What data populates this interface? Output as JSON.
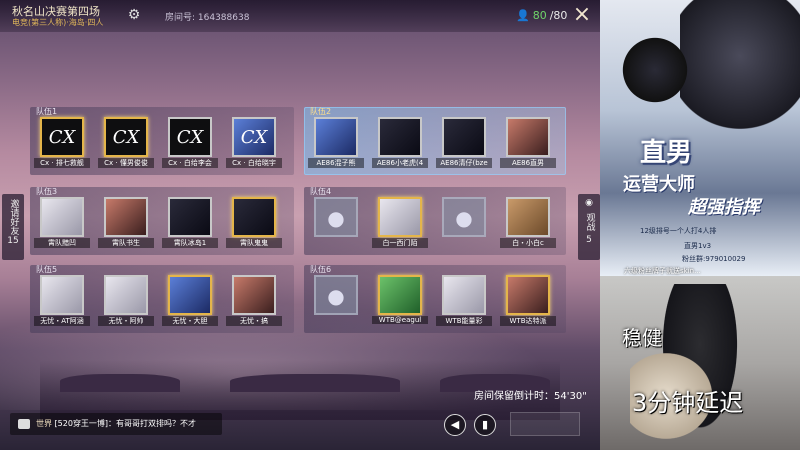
{
  "header": {
    "mode_title": "秋名山决赛第四场",
    "mode_sub": "电竞(第三人称)·海岛·四人",
    "room_label": "房间号: 164388638",
    "player_count_current": "80",
    "player_count_total": "/80",
    "close_icon": "×"
  },
  "teams": [
    {
      "label": "队伍1",
      "highlighted": false,
      "players": [
        "Cx · 排七救舰",
        "Cx · 懂男俊俊",
        "Cx · 白给李会",
        "Cx · 白给晓宇"
      ]
    },
    {
      "label": "队伍2",
      "highlighted": true,
      "players": [
        "AE86混子熊",
        "AE86小老虎(4",
        "AE86清仔(bze",
        "AE86直男"
      ]
    },
    {
      "label": "队伍3",
      "highlighted": false,
      "players": [
        "霄队黯凹",
        "霄队书生",
        "霄队冰岛1",
        "霄队鬼鬼"
      ]
    },
    {
      "label": "队伍4",
      "highlighted": false,
      "players": [
        "",
        "白一西门陌",
        "",
        "白・小白c"
      ]
    },
    {
      "label": "队伍5",
      "highlighted": false,
      "players": [
        "无忧・AT阿涵",
        "无忧・阿帅",
        "无忧・大胆",
        "无忧・搞"
      ]
    },
    {
      "label": "队伍6",
      "highlighted": false,
      "players": [
        "",
        "WTB@eagul",
        "WTB能量彩",
        "WTB达特派"
      ]
    }
  ],
  "side": {
    "invite_label": "邀请好友",
    "invite_count": "15",
    "watch_label": "观战",
    "watch_count": "5"
  },
  "countdown": "房间保留倒计时：54'30\"",
  "chat": {
    "channel": "世界",
    "message": "[520穿王一博]：有哥哥打双排吗？不才"
  },
  "poster": {
    "big": "直男",
    "line1": "运营大师",
    "line2": "超强指挥",
    "small1": "12级排号一个人打4人排",
    "small2": "直男1v3",
    "small3": "粉丝群:979010029",
    "small4": "六级粉丝牌子就送skin..."
  },
  "camera": {
    "caption1": "稳健",
    "caption2": "3分钟延迟"
  },
  "colors": {
    "accent_gold": "#e4b54a",
    "count_green": "#6fd46a"
  }
}
